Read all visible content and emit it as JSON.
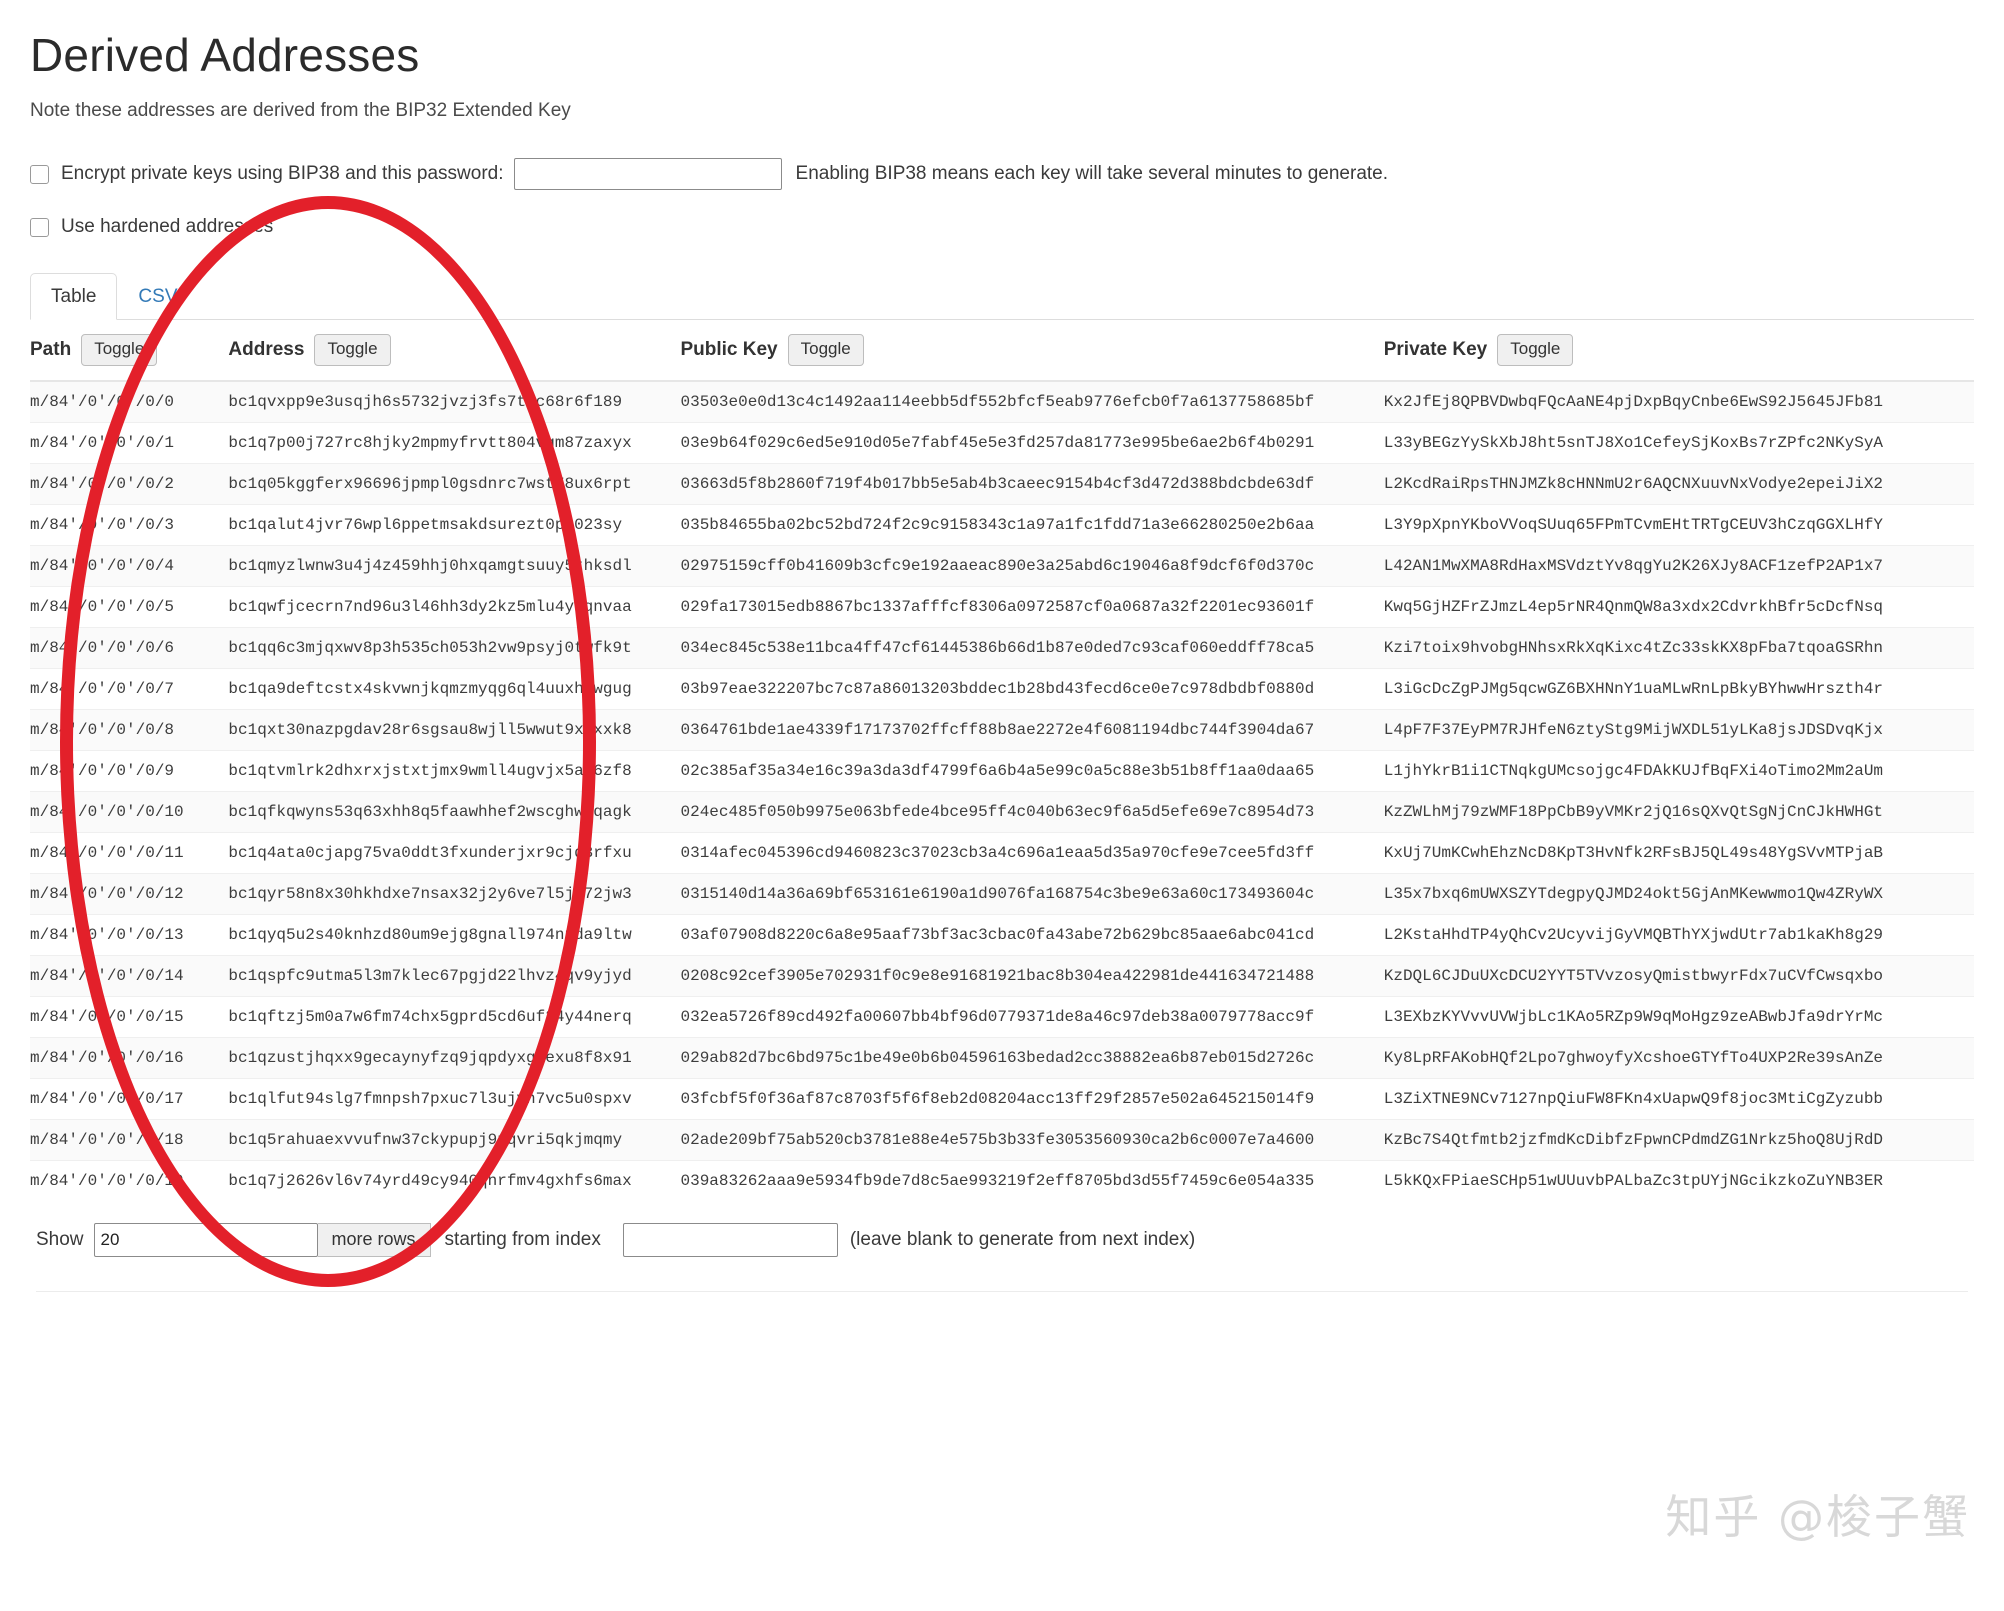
{
  "header": {
    "title": "Derived Addresses",
    "note": "Note these addresses are derived from the BIP32 Extended Key"
  },
  "options": {
    "bip38_label": "Encrypt private keys using BIP38 and this password:",
    "bip38_value": "",
    "bip38_placeholder": "",
    "bip38_hint": "Enabling BIP38 means each key will take several minutes to generate.",
    "hardened_label": "Use hardened addresses"
  },
  "tabs": [
    {
      "label": "Table",
      "active": true
    },
    {
      "label": "CSV",
      "active": false
    }
  ],
  "table": {
    "toggle_label": "Toggle",
    "columns": [
      {
        "key": "path",
        "label": "Path"
      },
      {
        "key": "address",
        "label": "Address"
      },
      {
        "key": "public_key",
        "label": "Public Key"
      },
      {
        "key": "private_key",
        "label": "Private Key"
      }
    ],
    "rows": [
      {
        "path": "m/84'/0'/0'/0/0",
        "address": "bc1qvxpp9e3usqjh6s5732jvzj3fs7tzc68r6f189",
        "public_key": "03503e0e0d13c4c1492aa114eebb5df552bfcf5eab9776efcb0f7a6137758685bf",
        "private_key": "Kx2JfEj8QPBVDwbqFQcAaNE4pjDxpBqyCnbe6EwS92J5645JFb81"
      },
      {
        "path": "m/84'/0'/0'/0/1",
        "address": "bc1q7p00j727rc8hjky2mpmyfrvtt804vgm87zaxyx",
        "public_key": "03e9b64f029c6ed5e910d05e7fabf45e5e3fd257da81773e995be6ae2b6f4b0291",
        "private_key": "L33yBEGzYySkXbJ8ht5snTJ8Xo1CefeySjKoxBs7rZPfc2NKySyA"
      },
      {
        "path": "m/84'/0'/0'/0/2",
        "address": "bc1q05kggferx96696jpmpl0gsdnrc7wst78ux6rpt",
        "public_key": "03663d5f8b2860f719f4b017bb5e5ab4b3caeec9154b4cf3d472d388bdcbde63df",
        "private_key": "L2KcdRaiRpsTHNJMZk8cHNNmU2r6AQCNXuuvNxVodye2epeiJiX2"
      },
      {
        "path": "m/84'/0'/0'/0/3",
        "address": "bc1qalut4jvr76wpl6ppetmsakdsurezt0pu023sy",
        "public_key": "035b84655ba02bc52bd724f2c9c9158343c1a97a1fc1fdd71a3e66280250e2b6aa",
        "private_key": "L3Y9pXpnYKboVVoqSUuq65FPmTCvmEHtTRTgCEUV3hCzqGGXLHfY"
      },
      {
        "path": "m/84'/0'/0'/0/4",
        "address": "bc1qmyzlwnw3u4j4z459hhj0hxqamgtsuuy5thksdl",
        "public_key": "02975159cff0b41609b3cfc9e192aaeac890e3a25abd6c19046a8f9dcf6f0d370c",
        "private_key": "L42AN1MwXMA8RdHaxMSVdztYv8qgYu2K26XJy8ACF1zefP2AP1x7"
      },
      {
        "path": "m/84'/0'/0'/0/5",
        "address": "bc1qwfjcecrn7nd96u3l46hh3dy2kz5mlu4yqqnvaa",
        "public_key": "029fa173015edb8867bc1337afffcf8306a0972587cf0a0687a32f2201ec93601f",
        "private_key": "Kwq5GjHZFrZJmzL4ep5rNR4QnmQW8a3xdx2CdvrkhBfr5cDcfNsq"
      },
      {
        "path": "m/84'/0'/0'/0/6",
        "address": "bc1qq6c3mjqxwv8p3h535ch053h2vw9psyj0twfk9t",
        "public_key": "034ec845c538e11bca4ff47cf61445386b66d1b87e0ded7c93caf060eddff78ca5",
        "private_key": "Kzi7toix9hvobgHNhsxRkXqKixc4tZc33skKX8pFba7tqoaGSRhn"
      },
      {
        "path": "m/84'/0'/0'/0/7",
        "address": "bc1qa9deftcstx4skvwnjkqmzmyqg6ql4uuxhywgug",
        "public_key": "03b97eae322207bc7c87a86013203bddec1b28bd43fecd6ce0e7c978dbdbf0880d",
        "private_key": "L3iGcDcZgPJMg5qcwGZ6BXHNnY1uaMLwRnLpBkyBYhwwHrszth4r"
      },
      {
        "path": "m/84'/0'/0'/0/8",
        "address": "bc1qxt30nazpgdav28r6sgsau8wjll5wwut9x1xxk8",
        "public_key": "0364761bde1ae4339f17173702ffcff88b8ae2272e4f6081194dbc744f3904da67",
        "private_key": "L4pF7F37EyPM7RJHfeN6ztyStg9MijWXDL51yLKa8jsJDSDvqKjx"
      },
      {
        "path": "m/84'/0'/0'/0/9",
        "address": "bc1qtvmlrk2dhxrxjstxtjmx9wmll4ugvjx5a06zf8",
        "public_key": "02c385af35a34e16c39a3da3df4799f6a6b4a5e99c0a5c88e3b51b8ff1aa0daa65",
        "private_key": "L1jhYkrB1i1CTNqkgUMcsojgc4FDAkKUJfBqFXi4oTimo2Mm2aUm"
      },
      {
        "path": "m/84'/0'/0'/0/10",
        "address": "bc1qfkqwyns53q63xhh8q5faawhhef2wscghwrqagk",
        "public_key": "024ec485f050b9975e063bfede4bce95ff4c040b63ec9f6a5d5efe69e7c8954d73",
        "private_key": "KzZWLhMj79zWMF18PpCbB9yVMKr2jQ16sQXvQtSgNjCnCJkHWHGt"
      },
      {
        "path": "m/84'/0'/0'/0/11",
        "address": "bc1q4ata0cjapg75va0ddt3fxunderjxr9cjq3rfxu",
        "public_key": "0314afec045396cd9460823c37023cb3a4c696a1eaa5d35a970cfe9e7cee5fd3ff",
        "private_key": "KxUj7UmKCwhEhzNcD8KpT3HvNfk2RFsBJ5QL49s48YgSVvMTPjaB"
      },
      {
        "path": "m/84'/0'/0'/0/12",
        "address": "bc1qyr58n8x30hkhdxe7nsax32j2y6ve7l5jm72jw3",
        "public_key": "0315140d14a36a69bf653161e6190a1d9076fa168754c3be9e63a60c173493604c",
        "private_key": "L35x7bxq6mUWXSZYTdegpyQJMD24okt5GjAnMKewwmo1Qw4ZRyWX"
      },
      {
        "path": "m/84'/0'/0'/0/13",
        "address": "bc1qyq5u2s40knhzd80um9ejg8gnall974nuda9ltw",
        "public_key": "03af07908d8220c6a8e95aaf73bf3ac3cbac0fa43abe72b629bc85aae6abc041cd",
        "private_key": "L2KstaHhdTP4yQhCv2UcyvijGyVMQBThYXjwdUtr7ab1kaKh8g29"
      },
      {
        "path": "m/84'/0'/0'/0/14",
        "address": "bc1qspfc9utma5l3m7klec67pgjd22lhvz4qv9yjyd",
        "public_key": "0208c92cef3905e702931f0c9e8e91681921bac8b304ea422981de441634721488",
        "private_key": "KzDQL6CJDuUXcDCU2YYT5TVvzosyQmistbwyrFdx7uCVfCwsqxbo"
      },
      {
        "path": "m/84'/0'/0'/0/15",
        "address": "bc1qftzj5m0a7w6fm74chx5gprd5cd6uf24y44nerq",
        "public_key": "032ea5726f89cd492fa00607bb4bf96d0779371de8a46c97deb38a0079778acc9f",
        "private_key": "L3EXbzKYVvvUVWjbLc1KAo5RZp9W9qMoHgz9zeABwbJfa9drYrMc"
      },
      {
        "path": "m/84'/0'/0'/0/16",
        "address": "bc1qzustjhqxx9gecaynyfzq9jqpdyxg8exu8f8x91",
        "public_key": "029ab82d7bc6bd975c1be49e0b6b04596163bedad2cc38882ea6b87eb015d2726c",
        "private_key": "Ky8LpRFAKobHQf2Lpo7ghwoyfyXcshoeGTYfTo4UXP2Re39sAnZe"
      },
      {
        "path": "m/84'/0'/0'/0/17",
        "address": "bc1qlfut94slg7fmnpsh7pxuc7l3ujvh7vc5u0spxv",
        "public_key": "03fcbf5f0f36af87c8703f5f6f8eb2d08204acc13ff29f2857e502a645215014f9",
        "private_key": "L3ZiXTNE9NCv7127npQiuFW8FKn4xUapwQ9f8joc3MtiCgZyzubb"
      },
      {
        "path": "m/84'/0'/0'/0/18",
        "address": "bc1q5rahuaexvvufnw37ckypupj9nqvri5qkjmqmy",
        "public_key": "02ade209bf75ab520cb3781e88e4e575b3b33fe3053560930ca2b6c0007e7a4600",
        "private_key": "KzBc7S4Qtfmtb2jzfmdKcDibfzFpwnCPdmdZG1Nrkz5hoQ8UjRdD"
      },
      {
        "path": "m/84'/0'/0'/0/19",
        "address": "bc1q7j2626vl6v74yrd49cy940qnrfmv4gxhfs6max",
        "public_key": "039a83262aaa9e5934fb9de7d8c5ae993219f2eff8705bd3d55f7459c6e054a335",
        "private_key": "L5kKQxFPiaeSCHp51wUUuvbPALbaZc3tpUYjNGcikzkoZuYNB3ER"
      }
    ]
  },
  "footer": {
    "show_label": "Show",
    "rows_count_value": "20",
    "more_rows_label": "more rows",
    "starting_label": "starting from index",
    "start_index_value": "",
    "hint": "(leave blank to generate from next index)"
  },
  "watermark": "知乎 @梭子蟹",
  "colors": {
    "annotation_red": "#e3202a",
    "link_blue": "#337ab7"
  }
}
